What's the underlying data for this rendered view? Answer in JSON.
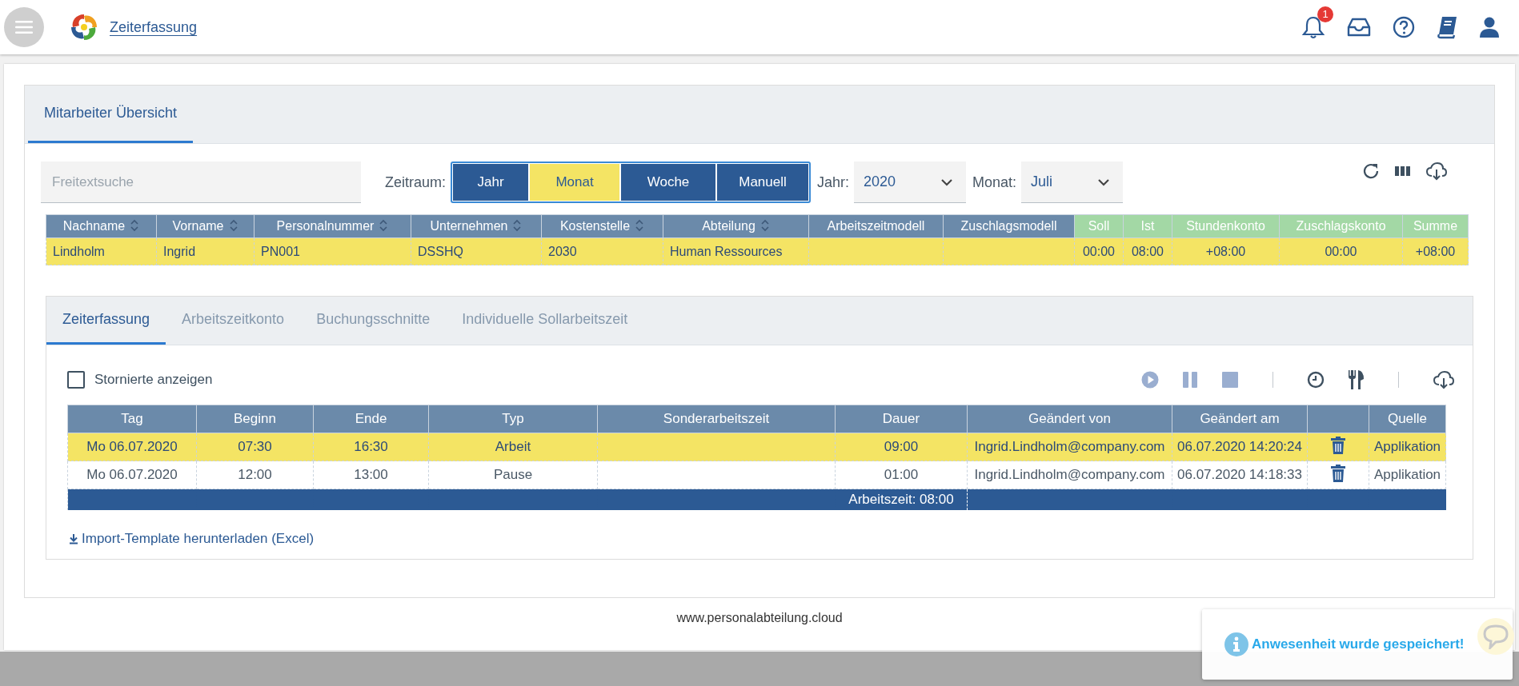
{
  "header": {
    "title": "Zeiterfassung",
    "notification_count": "1"
  },
  "overview": {
    "tab": {
      "label": "Mitarbeiter Übersicht",
      "selected": true
    },
    "search": {
      "placeholder": "Freitextsuche"
    },
    "period_label": "Zeitraum:",
    "period_options": [
      {
        "label": "Jahr",
        "selected": false
      },
      {
        "label": "Monat",
        "selected": true
      },
      {
        "label": "Woche",
        "selected": false
      },
      {
        "label": "Manuell",
        "selected": false
      }
    ],
    "year": {
      "label": "Jahr:",
      "value": "2020"
    },
    "month": {
      "label": "Monat:",
      "value": "Juli"
    },
    "table": {
      "columns": [
        {
          "label": "Nachname",
          "sortable": true,
          "kind": "attribute"
        },
        {
          "label": "Vorname",
          "sortable": true,
          "kind": "attribute"
        },
        {
          "label": "Personalnummer",
          "sortable": true,
          "kind": "attribute"
        },
        {
          "label": "Unternehmen",
          "sortable": true,
          "kind": "attribute"
        },
        {
          "label": "Kostenstelle",
          "sortable": true,
          "kind": "attribute"
        },
        {
          "label": "Abteilung",
          "sortable": true,
          "kind": "attribute"
        },
        {
          "label": "Arbeitszeitmodell",
          "sortable": false,
          "kind": "attribute"
        },
        {
          "label": "Zuschlagsmodell",
          "sortable": false,
          "kind": "attribute"
        },
        {
          "label": "Soll",
          "sortable": false,
          "kind": "balance"
        },
        {
          "label": "Ist",
          "sortable": false,
          "kind": "balance"
        },
        {
          "label": "Stundenkonto",
          "sortable": false,
          "kind": "balance"
        },
        {
          "label": "Zuschlagskonto",
          "sortable": false,
          "kind": "balance"
        },
        {
          "label": "Summe",
          "sortable": false,
          "kind": "balance"
        }
      ],
      "rows": [
        {
          "highlighted": true,
          "cells": [
            "Lindholm",
            "Ingrid",
            "PN001",
            "DSSHQ",
            "2030",
            "Human Ressources",
            null,
            null,
            "00:00",
            "08:00",
            "+08:00",
            "00:00",
            "+08:00"
          ]
        }
      ]
    }
  },
  "details": {
    "tabs": [
      {
        "label": "Zeiterfassung",
        "selected": true
      },
      {
        "label": "Arbeitszeitkonto",
        "selected": false
      },
      {
        "label": "Buchungsschnitte",
        "selected": false
      },
      {
        "label": "Individuelle Sollarbeitszeit",
        "selected": false
      }
    ],
    "show_cancelled": {
      "label": "Stornierte anzeigen",
      "checked": false
    },
    "table": {
      "columns": [
        {
          "label": "Tag"
        },
        {
          "label": "Beginn"
        },
        {
          "label": "Ende"
        },
        {
          "label": "Typ"
        },
        {
          "label": "Sonderarbeitszeit"
        },
        {
          "label": "Dauer"
        },
        {
          "label": "Geändert von"
        },
        {
          "label": "Geändert am"
        },
        {
          "kind": "action"
        },
        {
          "label": "Quelle"
        }
      ],
      "rows": [
        {
          "highlighted": true,
          "deletable": true,
          "cells": [
            "Mo 06.07.2020",
            "07:30",
            "16:30",
            "Arbeit",
            null,
            "09:00",
            "Ingrid.Lindholm@company.com",
            "06.07.2020 14:20:24",
            null,
            "Applikation"
          ]
        },
        {
          "highlighted": false,
          "deletable": true,
          "cells": [
            "Mo 06.07.2020",
            "12:00",
            "13:00",
            "Pause",
            null,
            "01:00",
            "Ingrid.Lindholm@company.com",
            "06.07.2020 14:18:33",
            null,
            "Applikation"
          ]
        }
      ],
      "total_row": {
        "cells": [
          null,
          null,
          null,
          null,
          null,
          "Arbeitszeit: 08:00",
          null,
          null,
          null,
          null
        ]
      }
    },
    "import_link": "Import-Template herunterladen (Excel)"
  },
  "footer": "www.personalabteilung.cloud",
  "toast": {
    "message": "Anwesenheit wurde gespeichert!"
  }
}
